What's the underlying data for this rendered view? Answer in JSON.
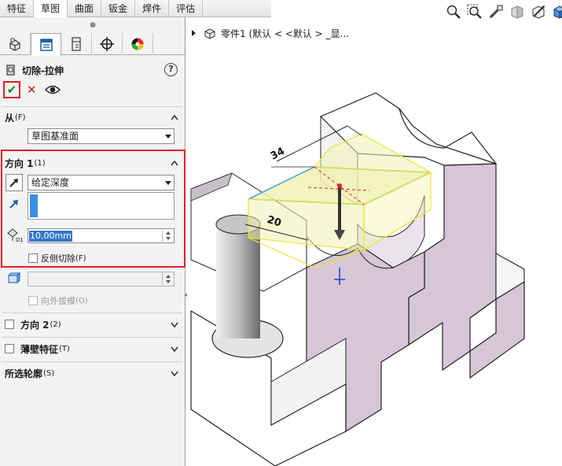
{
  "tabs": [
    "特征",
    "草图",
    "曲面",
    "钣金",
    "焊件",
    "评估"
  ],
  "active_tab": "草图",
  "property_manager": {
    "title": "切除-拉伸",
    "help": "?",
    "from": {
      "label": "从",
      "shortcut": "(F)",
      "value": "草图基准面"
    },
    "direction1": {
      "label": "方向 1",
      "shortcut": "(1)",
      "end_condition": "给定深度",
      "depth": "10.00mm",
      "flip_side_cut_label": "反侧切除",
      "flip_side_cut_shortcut": "(F)",
      "draft_outward_label": "向外拔模",
      "draft_outward_shortcut": "(O)"
    },
    "direction2": {
      "label": "方向 2",
      "shortcut": "(2)"
    },
    "thin_feature": {
      "label": "薄壁特征",
      "shortcut": "(T)"
    },
    "selected_contours": {
      "label": "所选轮廓",
      "shortcut": "(S)"
    }
  },
  "feature_tree": {
    "part_label": "零件1  (默认 < <默认 > _显..."
  },
  "model": {
    "dim_width": "34",
    "dim_depth": "20",
    "colors": {
      "face_white": "#ffffff",
      "face_purple": "#d6c6d8",
      "preview_yellow": "#f1f1b2",
      "outline_blue": "#4aa3e8",
      "outline_yellow": "#e6e632",
      "highlight_red": "#e0202a"
    }
  },
  "icons": {
    "view_toolbar": [
      "zoom-to-fit-icon",
      "zoom-to-area-icon",
      "previous-view-icon",
      "section-view-icon",
      "view-orientation-icon",
      "display-style-icon"
    ]
  }
}
